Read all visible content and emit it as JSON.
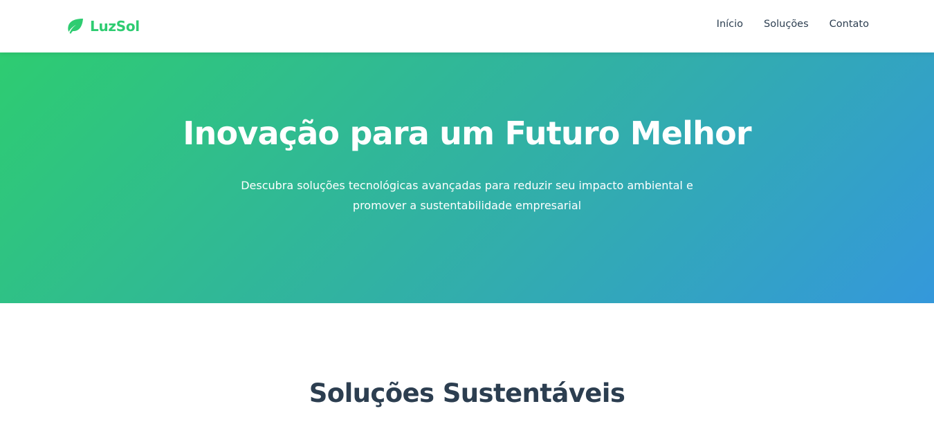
{
  "brand": {
    "name": "LuzSol",
    "icon": "leaf-icon",
    "color": "#2ecc71"
  },
  "nav": {
    "items": [
      {
        "label": "Início"
      },
      {
        "label": "Soluções"
      },
      {
        "label": "Contato"
      }
    ]
  },
  "hero": {
    "title": "Inovação para um Futuro Melhor",
    "subtitle": "Descubra soluções tecnológicas avançadas para reduzir seu impacto ambiental e promover a sustentabilidade empresarial",
    "gradient_start": "#2ecc71",
    "gradient_end": "#3498db"
  },
  "solutions": {
    "title": "Soluções Sustentáveis"
  }
}
